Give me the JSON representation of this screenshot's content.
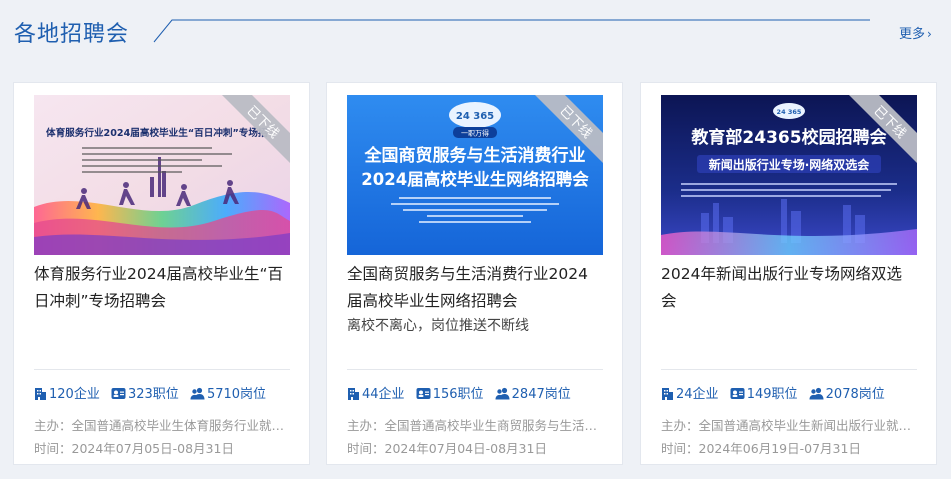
{
  "header": {
    "title": "各地招聘会",
    "more_label": "更多",
    "more_chevron": "›"
  },
  "cards": [
    {
      "ribbon": "已下线",
      "banner_line1": "体育服务行业2024届高校毕业生“百日冲刺”专场招",
      "title": "体育服务行业2024届高校毕业生“百日冲刺”专场招聘会",
      "subtitle": "",
      "companies": "120企业",
      "positions": "323职位",
      "jobs": "5710岗位",
      "host": "主办：全国普通高校毕业生体育服务行业就业创业促进中心",
      "time": "时间：2024年07月05日-08月31日"
    },
    {
      "ribbon": "已下线",
      "banner_badge": "24 365",
      "banner_badge_sub": "一职万得",
      "banner_line1": "全国商贸服务与生活消费行业",
      "banner_line2": "2024届高校毕业生网络招聘会",
      "title": "全国商贸服务与生活消费行业2024届高校毕业生网络招聘会",
      "subtitle": "离校不离心，岗位推送不断线",
      "companies": "44企业",
      "positions": "156职位",
      "jobs": "2847岗位",
      "host": "主办：全国普通高校毕业生商贸服务与生活消费行业就业创业促进中心",
      "time": "时间：2024年07月04日-08月31日"
    },
    {
      "ribbon": "已下线",
      "banner_badge": "24 365",
      "banner_line1": "教育部24365校园招聘会",
      "banner_line2": "新闻出版行业专场·网络双选会",
      "title": "2024年新闻出版行业专场网络双选会",
      "subtitle": "",
      "companies": "24企业",
      "positions": "149职位",
      "jobs": "2078岗位",
      "host": "主办：全国普通高校毕业生新闻出版行业就业创业促进中心",
      "time": "时间：2024年06月19日-07月31日"
    }
  ],
  "colors": {
    "accent": "#1f5fb0",
    "muted": "#999999",
    "ribbon": "#b9bcc4"
  },
  "icons": {
    "company": "building-icon",
    "position": "id-card-icon",
    "job": "people-icon"
  }
}
